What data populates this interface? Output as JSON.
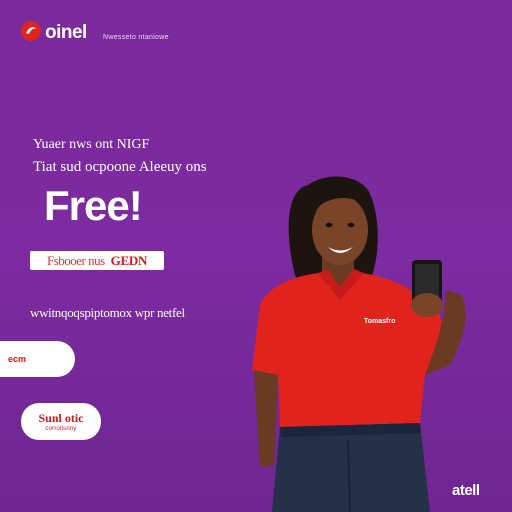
{
  "header": {
    "logo_text": "oinel",
    "tagline": "Nwesseto ntaniowe"
  },
  "hero": {
    "line1": "Yuaer nws ont NIGF",
    "line2": "Tiat sud ocpoone Aleeuy ons",
    "title": "Free!"
  },
  "promo": {
    "label": "Fsbooer nus",
    "code": "GEDN"
  },
  "subtext": "wwitnqoqspiptomox wpr netfel",
  "cta": {
    "label": "ecm"
  },
  "info": {
    "title": "Sunl otic",
    "subtitle": "corrollsnny"
  },
  "person": {
    "shirt_badge": "Tomasfro"
  },
  "brand_footer": "atell",
  "colors": {
    "background": "#7a2a9c",
    "accent_red": "#e0231d",
    "white": "#ffffff"
  }
}
